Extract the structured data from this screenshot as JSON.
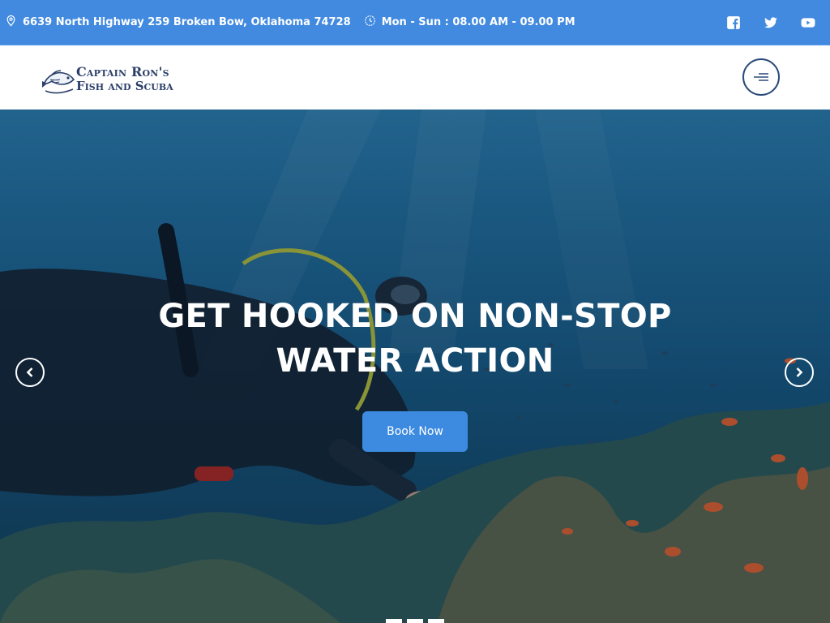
{
  "topbar": {
    "address": "6639 North Highway 259 Broken Bow, Oklahoma 74728",
    "hours": "Mon - Sun : 08.00 AM - 09.00 PM",
    "social": [
      "facebook-icon",
      "twitter-icon",
      "youtube-icon"
    ]
  },
  "header": {
    "logo_line1": "Captain Ron's",
    "logo_line2": "Fish and Scuba"
  },
  "hero": {
    "headline": "GET HOOKED ON NON-STOP WATER ACTION",
    "button_label": "Book Now",
    "slider_dots": 3
  },
  "colors": {
    "topbar": "#418ae0",
    "button": "#3d8be0",
    "logo_text": "#2b3f6a"
  }
}
